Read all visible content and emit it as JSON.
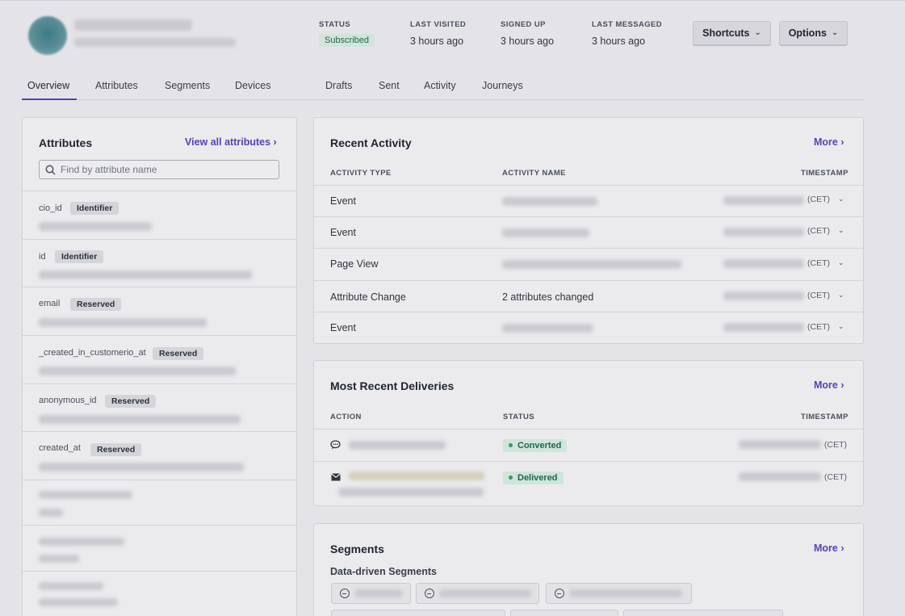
{
  "header": {
    "status_label": "STATUS",
    "status_value": "Subscribed",
    "last_visited_label": "LAST VISITED",
    "last_visited_value": "3 hours ago",
    "signed_up_label": "SIGNED UP",
    "signed_up_value": "3 hours ago",
    "last_messaged_label": "LAST MESSAGED",
    "last_messaged_value": "3 hours ago",
    "shortcuts_button": "Shortcuts",
    "options_button": "Options"
  },
  "tabs": [
    {
      "label": "Overview",
      "active": true
    },
    {
      "label": "Attributes"
    },
    {
      "label": "Segments"
    },
    {
      "label": "Devices"
    },
    {
      "label": "Drafts"
    },
    {
      "label": "Sent"
    },
    {
      "label": "Activity"
    },
    {
      "label": "Journeys"
    }
  ],
  "attributes_card": {
    "title": "Attributes",
    "view_all": "View all attributes ›",
    "search_placeholder": "Find by attribute name",
    "rows": [
      {
        "key": "cio_id",
        "tag": "Identifier"
      },
      {
        "key": "id",
        "tag": "Identifier"
      },
      {
        "key": "email",
        "tag": "Reserved"
      },
      {
        "key": "_created_in_customerio_at",
        "tag": "Reserved"
      },
      {
        "key": "anonymous_id",
        "tag": "Reserved"
      },
      {
        "key": "created_at",
        "tag": "Reserved"
      }
    ]
  },
  "recent_activity": {
    "title": "Recent Activity",
    "more": "More ›",
    "col_type": "ACTIVITY TYPE",
    "col_name": "ACTIVITY NAME",
    "col_timestamp": "TIMESTAMP",
    "tz": "(CET)",
    "rows": [
      {
        "type": "Event",
        "name": ""
      },
      {
        "type": "Event",
        "name": ""
      },
      {
        "type": "Page View",
        "name": ""
      },
      {
        "type": "Attribute Change",
        "name": "2 attributes changed"
      },
      {
        "type": "Event",
        "name": ""
      }
    ]
  },
  "deliveries": {
    "title": "Most Recent Deliveries",
    "more": "More ›",
    "col_action": "ACTION",
    "col_status": "STATUS",
    "col_timestamp": "TIMESTAMP",
    "tz": "(CET)",
    "rows": [
      {
        "icon": "chat-bubble-icon",
        "status": "Converted"
      },
      {
        "icon": "envelope-icon",
        "status": "Delivered"
      }
    ]
  },
  "segments": {
    "title": "Segments",
    "more": "More ›",
    "subtitle": "Data-driven Segments"
  },
  "colors": {
    "accent": "#5b3fb8",
    "success_bg": "#cfe4da",
    "success_text": "#1b6a49"
  }
}
